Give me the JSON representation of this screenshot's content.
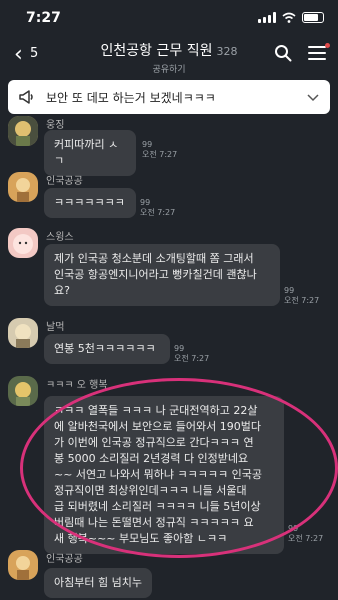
{
  "status": {
    "time": "7:27"
  },
  "header": {
    "back_count": "5",
    "title": "인천공항 근무 직원",
    "member_count": "328",
    "subtitle": "공유하기"
  },
  "notice": {
    "text": "보안 또 데모 하는거 보겠네ㅋㅋㅋ"
  },
  "messages": [
    {
      "sender": "웅징",
      "text": "커피따까리 ㅅㄱ",
      "unread": "99",
      "time": "오전 7:27"
    },
    {
      "sender": "인국공공",
      "text": "ㅋㅋㅋㅋㅋㅋㅋ",
      "unread": "99",
      "time": "오전 7:27"
    },
    {
      "sender": "스윙스",
      "text": "제가 인국공 청소분데 소개팅할때 쫌 그래서\n인국공 항공엔지니어라고 뻥카칠건데 괜찮나\n요?",
      "unread": "99",
      "time": "오전 7:27"
    },
    {
      "sender": "날먹",
      "text": "연봉 5천ㅋㅋㅋㅋㅋㅋ",
      "unread": "99",
      "time": "오전 7:27"
    },
    {
      "sender": "ㅋㅋㅋ 오 행복",
      "text": "ㅋㅋㅋ 열폭들 ㅋㅋㅋ 나 군대전역하고 22살\n에 알바천국에서 보안으로 들어와서 190벌다\n가 이번에 인국공 정규직으로 간다ㅋㅋㅋ 연\n봉 5000 소리질러 2년경력 다 인정받네요\n~~ 서연고 나와서 뭐하냐 ㅋㅋㅋㅋㅋ 인국공\n정규직이면 최상위인데ㅋㅋㅋ 니들 서울대\n급 되버렸네 소리질러 ㅋㅋㅋㅋ 니들 5년이상\n버림때 나는 돈떨면서 정규직 ㅋㅋㅋㅋㅋ 요\n새 행복~~~ 부모님도 좋아함 ㄴㅋㅋ",
      "unread": "99",
      "time": "오전 7:27"
    },
    {
      "sender": "인국공공",
      "text": "아침부터 힘 넘치누",
      "unread": "",
      "time": ""
    }
  ]
}
